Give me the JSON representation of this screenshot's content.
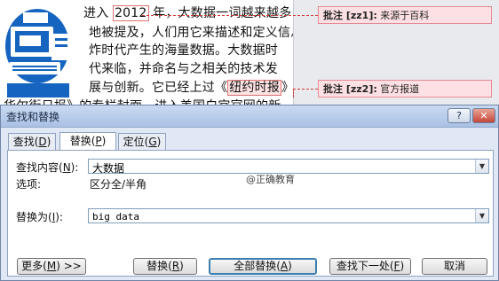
{
  "document": {
    "lines": [
      {
        "before": "进入 ",
        "highlight1": "2012",
        "after": " 年，大数据一词越来越多"
      },
      {
        "text": "地被提及，人们用它来描述和定义信息爆"
      },
      {
        "text": "炸时代产生的海量数据。大数据时"
      },
      {
        "text": "代来临，并命名与之相关的技术发"
      },
      {
        "before": "展与创新。它已经上过《",
        "highlight2": "纽约时报",
        "after": "》"
      },
      {
        "text": "华尔街日报》的专栏封面，进入美国白宫官网的新"
      }
    ],
    "comments": [
      {
        "label": "批注 [zz1]:",
        "text": "来源于百科"
      },
      {
        "label": "批注 [zz2]:",
        "text": "官方报道"
      }
    ]
  },
  "dialog": {
    "title": "查找和替换",
    "help": "?",
    "close": "✕",
    "tabs": [
      {
        "label": "查找(",
        "key": "D",
        "end": ")"
      },
      {
        "label": "替换(",
        "key": "P",
        "end": ")"
      },
      {
        "label": "定位(",
        "key": "G",
        "end": ")"
      }
    ],
    "find": {
      "label_pre": "查找内容(",
      "label_key": "N",
      "label_post": "):",
      "value": "大数据"
    },
    "options": {
      "label": "选项:",
      "value": "区分全/半角"
    },
    "watermark": "@正确教育",
    "replace": {
      "label_pre": "替换为(",
      "label_key": "I",
      "label_post": "):",
      "value": "big data"
    },
    "buttons": {
      "more": {
        "pre": "更多(",
        "key": "M",
        "post": ") >>"
      },
      "replace": {
        "pre": "替换(",
        "key": "R",
        "post": ")"
      },
      "replace_all": {
        "pre": "全部替换(",
        "key": "A",
        "post": ")"
      },
      "find_next": {
        "pre": "查找下一处(",
        "key": "F",
        "post": ")"
      },
      "cancel": "取消"
    }
  }
}
